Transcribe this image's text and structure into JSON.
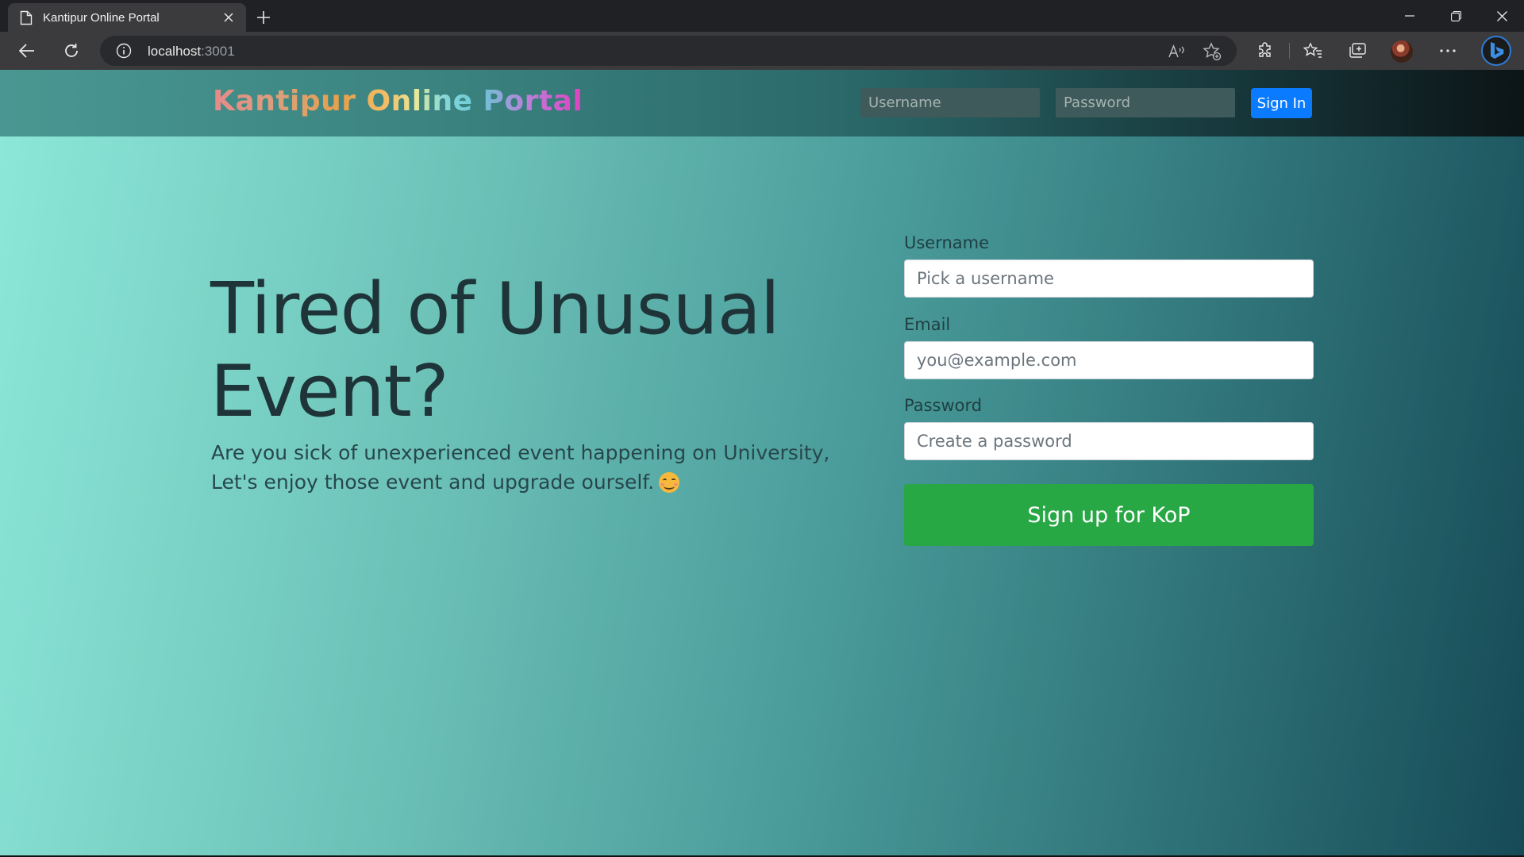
{
  "browser": {
    "tab_title": "Kantipur Online Portal",
    "url_host": "localhost",
    "url_port": ":3001",
    "icons": [
      "page-icon",
      "close-icon",
      "plus-icon",
      "minimize-icon",
      "restore-icon",
      "window-close-icon",
      "back-arrow-icon",
      "reload-icon",
      "info-icon",
      "read-aloud-icon",
      "add-favorite-icon",
      "extensions-icon",
      "favorites-icon",
      "collections-icon",
      "more-icon",
      "bing-icon"
    ]
  },
  "site": {
    "brand": "Kantipur Online Portal",
    "nav_username_placeholder": "Username",
    "nav_password_placeholder": "Password",
    "signin_label": "Sign In"
  },
  "hero": {
    "title": "Tired of Unusual Event?",
    "text": "Are you sick of unexperienced event happening on University, Let's enjoy those event and upgrade ourself."
  },
  "signup_form": {
    "username_label": "Username",
    "username_placeholder": "Pick a username",
    "email_label": "Email",
    "email_placeholder": "you@example.com",
    "password_label": "Password",
    "password_placeholder": "Create a password",
    "submit_label": "Sign up for KoP"
  },
  "colors": {
    "signin_button": "#0a7bff",
    "signup_button": "#28a745"
  }
}
